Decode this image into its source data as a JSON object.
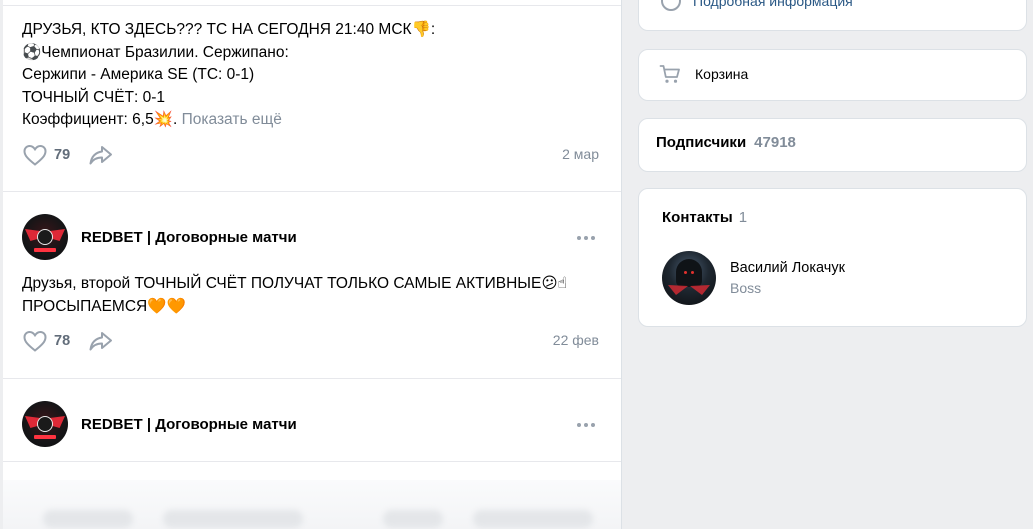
{
  "feed": {
    "posts": [
      {
        "text_main": "ДРУЗЬЯ, КТО ЗДЕСЬ??? ТС НА СЕГОДНЯ 21:40 МСК👎:\n⚽Чемпионат Бразилии. Сержипано:\nСержипи - Америка SE (ТС: 0-1)\nТОЧНЫЙ СЧЁТ: 0-1\nКоэффициент: 6,5💥.",
        "show_more": "Показать ещё",
        "likes": "79",
        "date": "2 мар"
      },
      {
        "author": "REDBET | Договорные матчи",
        "text_main": "Друзья, второй ТОЧНЫЙ СЧЁТ ПОЛУЧАТ ТОЛЬКО САМЫЕ АКТИВНЫЕ😕☝\nПРОСЫПАЕМСЯ🧡🧡",
        "likes": "78",
        "date": "22 фев"
      },
      {
        "author": "REDBET | Договорные матчи"
      }
    ]
  },
  "sidebar": {
    "info_link": "Подробная информация",
    "cart_label": "Корзина",
    "subscribers_label": "Подписчики",
    "subscribers_count": "47918",
    "contacts_title": "Контакты",
    "contacts_count": "1",
    "contacts": [
      {
        "name": "Василий Локачук",
        "role": "Boss"
      }
    ]
  },
  "colors": {
    "background": "#edeef0",
    "link": "#2a5885",
    "secondary_text": "#818c99",
    "icon_gray": "#99a2ad"
  }
}
